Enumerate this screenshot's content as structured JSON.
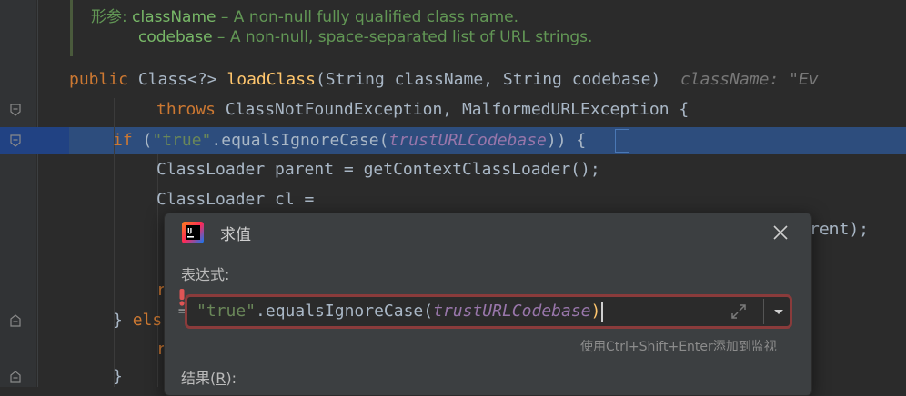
{
  "javadoc": {
    "params_label": "形参:",
    "param1_name": "className",
    "param1_desc": " – A non-null fully qualified class name.",
    "param2_name": "codebase",
    "param2_desc": " – A non-null, space-separated list of URL strings."
  },
  "code": {
    "l1_kw": "public",
    "l1_type": " Class<?> ",
    "l1_fn": "loadClass",
    "l1_rest": "(String className, String codebase)",
    "l1_hint": "className: \"Ev",
    "l2_kw": "throws",
    "l2_rest": " ClassNotFoundException, MalformedURLException {",
    "l3_kw": "if",
    "l3_open": " (",
    "l3_str": "\"true\"",
    "l3_call": ".equalsIgnoreCase(",
    "l3_field": "trustURLCodebase",
    "l3_close": ")) {",
    "l4": "ClassLoader parent = getContextClassLoader();",
    "l5": "ClassLoader cl =",
    "l6_tail": "rent);",
    "l7_frag": "r",
    "l8_brace": "} ",
    "l8_kw": "els",
    "l9_frag": "r",
    "l10": "}"
  },
  "dialog": {
    "title": "求值",
    "expression_label": "表达式:",
    "expr_str": "\"true\"",
    "expr_call": ".equalsIgnoreCase(",
    "expr_field": "trustURLCodebase",
    "expr_close": ")",
    "hint": "使用Ctrl+Shift+Enter添加到监视",
    "result_label_pre": "结果(",
    "result_label_key": "R",
    "result_label_post": "):",
    "equals_mark": "="
  },
  "colors": {
    "keyword": "#cc7832",
    "string": "#6a8759",
    "field": "#9876aa",
    "function": "#ffc66d",
    "selection": "#2d4d7d",
    "error_border": "#8a3b3b"
  },
  "icons": [
    "fold-icon",
    "intellij-logo-icon",
    "close-icon",
    "expand-icon",
    "dropdown-arrow-icon",
    "error-icon"
  ]
}
